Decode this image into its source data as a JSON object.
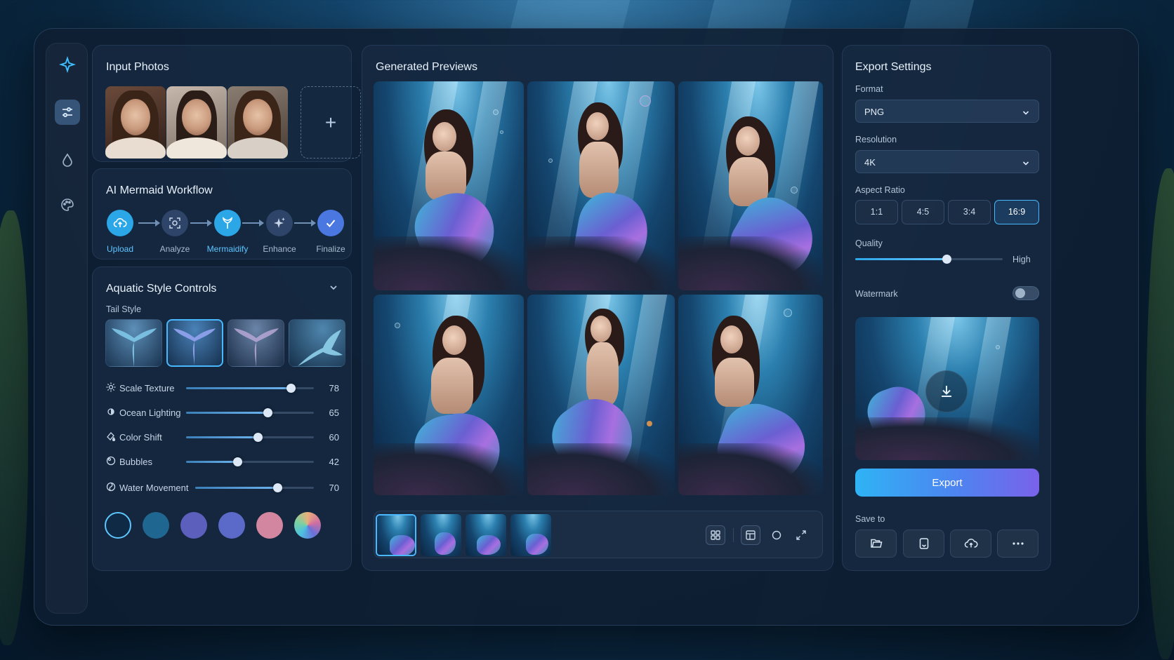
{
  "input_photos": {
    "title": "Input Photos",
    "add_icon": "+"
  },
  "workflow": {
    "title": "AI Mermaid Workflow",
    "steps": [
      {
        "label": "Upload",
        "icon": "cloud-upload-icon",
        "state": "highlighted"
      },
      {
        "label": "Analyze",
        "icon": "face-scan-icon",
        "state": "normal"
      },
      {
        "label": "Mermaidify",
        "icon": "mermaid-tail-icon",
        "state": "highlighted"
      },
      {
        "label": "Enhance",
        "icon": "sparkles-icon",
        "state": "normal"
      },
      {
        "label": "Finalize",
        "icon": "check-icon",
        "state": "done"
      }
    ]
  },
  "style_controls": {
    "title": "Aquatic Style Controls",
    "tail_style_label": "Tail Style",
    "selected_tail_index": 1,
    "sliders": [
      {
        "label": "Scale Texture",
        "value": 78,
        "icon": "scale-texture-icon"
      },
      {
        "label": "Ocean Lighting",
        "value": 65,
        "icon": "ocean-lighting-icon"
      },
      {
        "label": "Color Shift",
        "value": 60,
        "icon": "color-shift-icon"
      },
      {
        "label": "Bubbles",
        "value": 42,
        "icon": "bubbles-icon"
      },
      {
        "label": "Water Movement",
        "value": 70,
        "icon": "water-movement-icon"
      }
    ],
    "swatches": [
      "#0f2a44",
      "#1f6790",
      "#5d5fbd",
      "#5b6ac8",
      "#d2869f",
      "multi"
    ]
  },
  "previews": {
    "title": "Generated Previews"
  },
  "export": {
    "title": "Export Settings",
    "format_label": "Format",
    "format_value": "PNG",
    "resolution_label": "Resolution",
    "resolution_value": "4K",
    "aspect_label": "Aspect Ratio",
    "aspect_options": [
      "1:1",
      "4:5",
      "3:4",
      "16:9"
    ],
    "aspect_selected": "16:9",
    "quality_label": "Quality",
    "quality_value_label": "High",
    "quality_level": 0.62,
    "watermark_label": "Watermark",
    "watermark_on": false,
    "export_button": "Export",
    "save_to_label": "Save to"
  },
  "colors": {
    "accent": "#49b8ff",
    "export_gradient_start": "#2fb3f5",
    "export_gradient_end": "#7a62ea"
  }
}
